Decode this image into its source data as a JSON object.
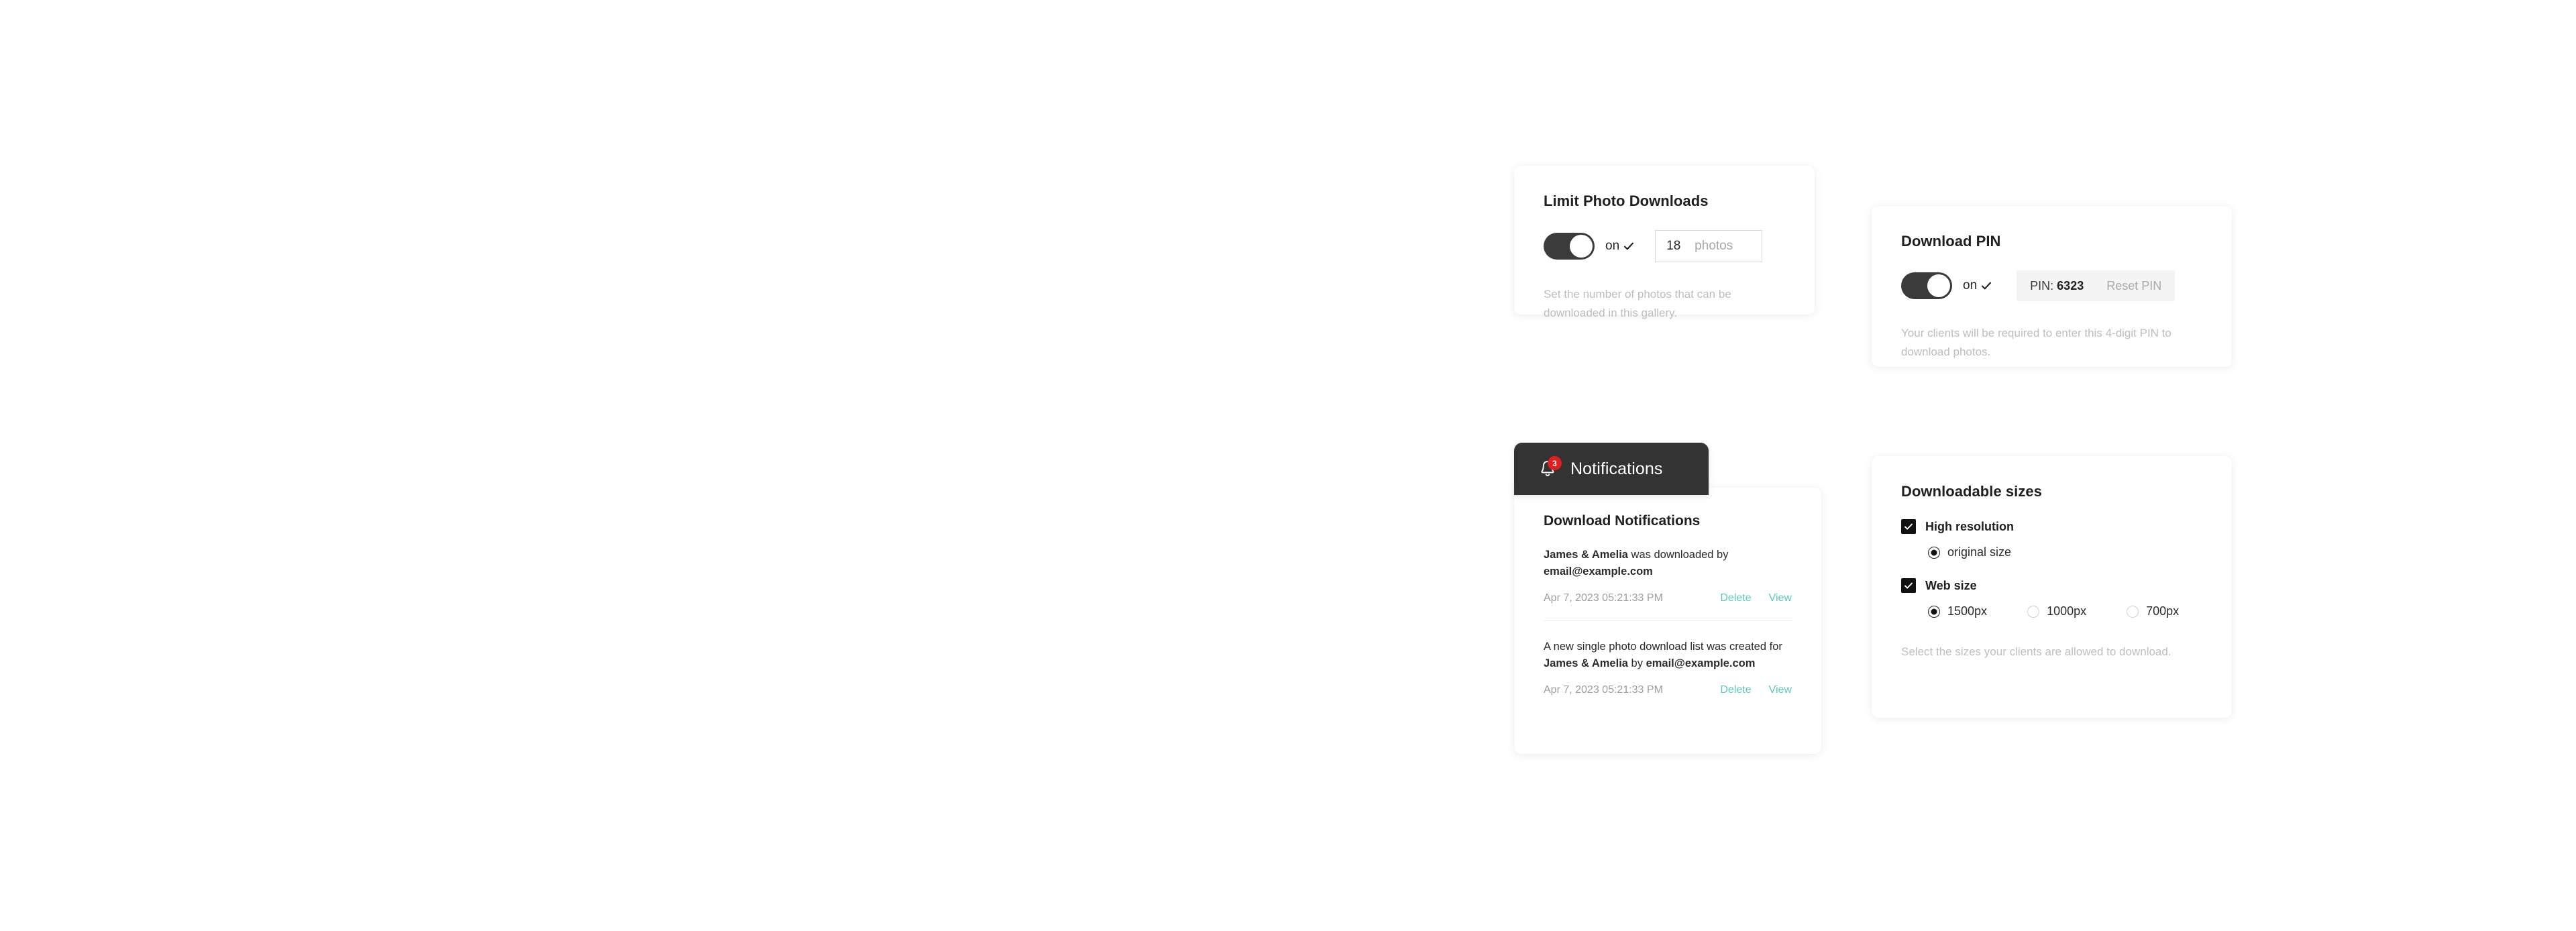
{
  "colors": {
    "toggle_on": "#3b3b3b",
    "link_teal": "#5cc9b4",
    "badge_red": "#e02020",
    "tab_dark": "#333333",
    "checkbox_black": "#111111",
    "page_background": "#ffffff",
    "card_background": "#ffffff",
    "helper_text": "#bdbdbd"
  },
  "limit_photo_downloads": {
    "title": "Limit Photo Downloads",
    "toggle_state": "on",
    "toggle_checked": true,
    "count_value": "18",
    "count_placeholder": "18",
    "count_unit": "photos",
    "helper": "Set the number of photos that can be downloaded in this gallery."
  },
  "download_pin": {
    "title": "Download PIN",
    "toggle_state": "on",
    "toggle_checked": true,
    "pin_label": "PIN:",
    "pin_value": "6323",
    "reset_label": "Reset PIN",
    "helper": "Your clients will be required to enter this 4-digit PIN to download photos."
  },
  "notifications": {
    "tab_label": "Notifications",
    "badge_count": "3",
    "bell_icon": "bell-icon",
    "panel_title": "Download Notifications",
    "items": [
      {
        "subject": "James & Amelia",
        "middle": " was downloaded by ",
        "email": "email@example.com",
        "suffix": "",
        "date": "Apr 7, 2023 05:21:33 PM",
        "delete_label": "Delete",
        "view_label": "View"
      },
      {
        "prefix": "A new single photo download list was created for ",
        "subject": "James & Amelia",
        "middle": " by ",
        "email": "email@example.com",
        "date": "Apr 7, 2023 05:21:33 PM",
        "delete_label": "Delete",
        "view_label": "View"
      }
    ]
  },
  "downloadable_sizes": {
    "title": "Downloadable sizes",
    "high_resolution": {
      "label": "High resolution",
      "checked": true,
      "options": [
        {
          "label": "original size",
          "selected": true
        }
      ]
    },
    "web_size": {
      "label": "Web size",
      "checked": true,
      "options": [
        {
          "label": "1500px",
          "selected": true
        },
        {
          "label": "1000px",
          "selected": false
        },
        {
          "label": "700px",
          "selected": false
        }
      ]
    },
    "helper": "Select the sizes your clients are allowed to download."
  }
}
